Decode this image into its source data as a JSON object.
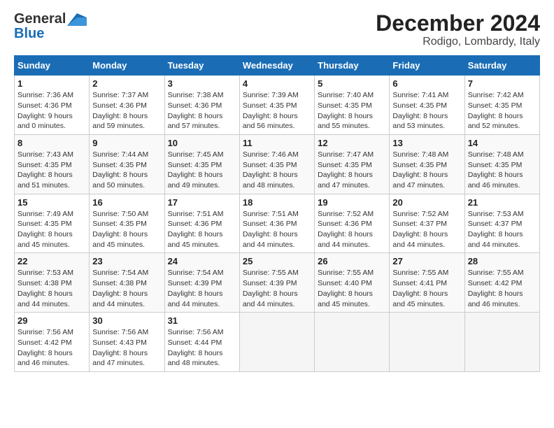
{
  "logo": {
    "line1": "General",
    "line2": "Blue"
  },
  "title": "December 2024",
  "subtitle": "Rodigo, Lombardy, Italy",
  "weekdays": [
    "Sunday",
    "Monday",
    "Tuesday",
    "Wednesday",
    "Thursday",
    "Friday",
    "Saturday"
  ],
  "weeks": [
    [
      {
        "day": "1",
        "sunrise": "7:36 AM",
        "sunset": "4:36 PM",
        "daylight": "9 hours and 0 minutes."
      },
      {
        "day": "2",
        "sunrise": "7:37 AM",
        "sunset": "4:36 PM",
        "daylight": "8 hours and 59 minutes."
      },
      {
        "day": "3",
        "sunrise": "7:38 AM",
        "sunset": "4:36 PM",
        "daylight": "8 hours and 57 minutes."
      },
      {
        "day": "4",
        "sunrise": "7:39 AM",
        "sunset": "4:35 PM",
        "daylight": "8 hours and 56 minutes."
      },
      {
        "day": "5",
        "sunrise": "7:40 AM",
        "sunset": "4:35 PM",
        "daylight": "8 hours and 55 minutes."
      },
      {
        "day": "6",
        "sunrise": "7:41 AM",
        "sunset": "4:35 PM",
        "daylight": "8 hours and 53 minutes."
      },
      {
        "day": "7",
        "sunrise": "7:42 AM",
        "sunset": "4:35 PM",
        "daylight": "8 hours and 52 minutes."
      }
    ],
    [
      {
        "day": "8",
        "sunrise": "7:43 AM",
        "sunset": "4:35 PM",
        "daylight": "8 hours and 51 minutes."
      },
      {
        "day": "9",
        "sunrise": "7:44 AM",
        "sunset": "4:35 PM",
        "daylight": "8 hours and 50 minutes."
      },
      {
        "day": "10",
        "sunrise": "7:45 AM",
        "sunset": "4:35 PM",
        "daylight": "8 hours and 49 minutes."
      },
      {
        "day": "11",
        "sunrise": "7:46 AM",
        "sunset": "4:35 PM",
        "daylight": "8 hours and 48 minutes."
      },
      {
        "day": "12",
        "sunrise": "7:47 AM",
        "sunset": "4:35 PM",
        "daylight": "8 hours and 47 minutes."
      },
      {
        "day": "13",
        "sunrise": "7:48 AM",
        "sunset": "4:35 PM",
        "daylight": "8 hours and 47 minutes."
      },
      {
        "day": "14",
        "sunrise": "7:48 AM",
        "sunset": "4:35 PM",
        "daylight": "8 hours and 46 minutes."
      }
    ],
    [
      {
        "day": "15",
        "sunrise": "7:49 AM",
        "sunset": "4:35 PM",
        "daylight": "8 hours and 45 minutes."
      },
      {
        "day": "16",
        "sunrise": "7:50 AM",
        "sunset": "4:35 PM",
        "daylight": "8 hours and 45 minutes."
      },
      {
        "day": "17",
        "sunrise": "7:51 AM",
        "sunset": "4:36 PM",
        "daylight": "8 hours and 45 minutes."
      },
      {
        "day": "18",
        "sunrise": "7:51 AM",
        "sunset": "4:36 PM",
        "daylight": "8 hours and 44 minutes."
      },
      {
        "day": "19",
        "sunrise": "7:52 AM",
        "sunset": "4:36 PM",
        "daylight": "8 hours and 44 minutes."
      },
      {
        "day": "20",
        "sunrise": "7:52 AM",
        "sunset": "4:37 PM",
        "daylight": "8 hours and 44 minutes."
      },
      {
        "day": "21",
        "sunrise": "7:53 AM",
        "sunset": "4:37 PM",
        "daylight": "8 hours and 44 minutes."
      }
    ],
    [
      {
        "day": "22",
        "sunrise": "7:53 AM",
        "sunset": "4:38 PM",
        "daylight": "8 hours and 44 minutes."
      },
      {
        "day": "23",
        "sunrise": "7:54 AM",
        "sunset": "4:38 PM",
        "daylight": "8 hours and 44 minutes."
      },
      {
        "day": "24",
        "sunrise": "7:54 AM",
        "sunset": "4:39 PM",
        "daylight": "8 hours and 44 minutes."
      },
      {
        "day": "25",
        "sunrise": "7:55 AM",
        "sunset": "4:39 PM",
        "daylight": "8 hours and 44 minutes."
      },
      {
        "day": "26",
        "sunrise": "7:55 AM",
        "sunset": "4:40 PM",
        "daylight": "8 hours and 45 minutes."
      },
      {
        "day": "27",
        "sunrise": "7:55 AM",
        "sunset": "4:41 PM",
        "daylight": "8 hours and 45 minutes."
      },
      {
        "day": "28",
        "sunrise": "7:55 AM",
        "sunset": "4:42 PM",
        "daylight": "8 hours and 46 minutes."
      }
    ],
    [
      {
        "day": "29",
        "sunrise": "7:56 AM",
        "sunset": "4:42 PM",
        "daylight": "8 hours and 46 minutes."
      },
      {
        "day": "30",
        "sunrise": "7:56 AM",
        "sunset": "4:43 PM",
        "daylight": "8 hours and 47 minutes."
      },
      {
        "day": "31",
        "sunrise": "7:56 AM",
        "sunset": "4:44 PM",
        "daylight": "8 hours and 48 minutes."
      },
      null,
      null,
      null,
      null
    ]
  ],
  "labels": {
    "sunrise": "Sunrise:",
    "sunset": "Sunset:",
    "daylight": "Daylight:"
  }
}
